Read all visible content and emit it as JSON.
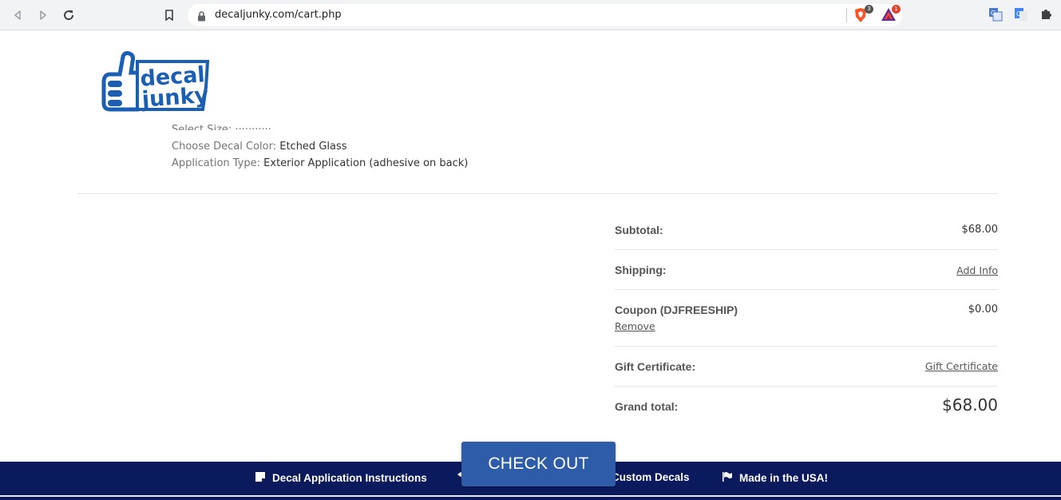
{
  "browser": {
    "url": "decaljunky.com/cart.php",
    "brave_badge": "3",
    "bat_badge": "1"
  },
  "logo": {
    "line1": "decal",
    "line2": "junky"
  },
  "options": [
    {
      "label": "Choose Decal Color:",
      "value": "Etched Glass"
    },
    {
      "label": "Application Type:",
      "value": "Exterior Application (adhesive on back)"
    }
  ],
  "totals": {
    "subtotal_label": "Subtotal:",
    "subtotal_value": "$68.00",
    "shipping_label": "Shipping:",
    "shipping_link": "Add Info",
    "coupon_label": "Coupon (DJFREESHIP)",
    "coupon_value": "$0.00",
    "coupon_remove": "Remove",
    "gift_label": "Gift Certificate:",
    "gift_link": "Gift Certificate",
    "grand_label": "Grand total:",
    "grand_value": "$68.00"
  },
  "checkout_label": "CHECK OUT",
  "footer": {
    "item1": "Decal Application Instructions",
    "item2": "Custom Decals",
    "item3": "Made in the USA!"
  },
  "colors": {
    "footer_bg": "#0a1a5c",
    "checkout_bg": "#2f5ca8",
    "logo_blue": "#1a5fb4"
  }
}
